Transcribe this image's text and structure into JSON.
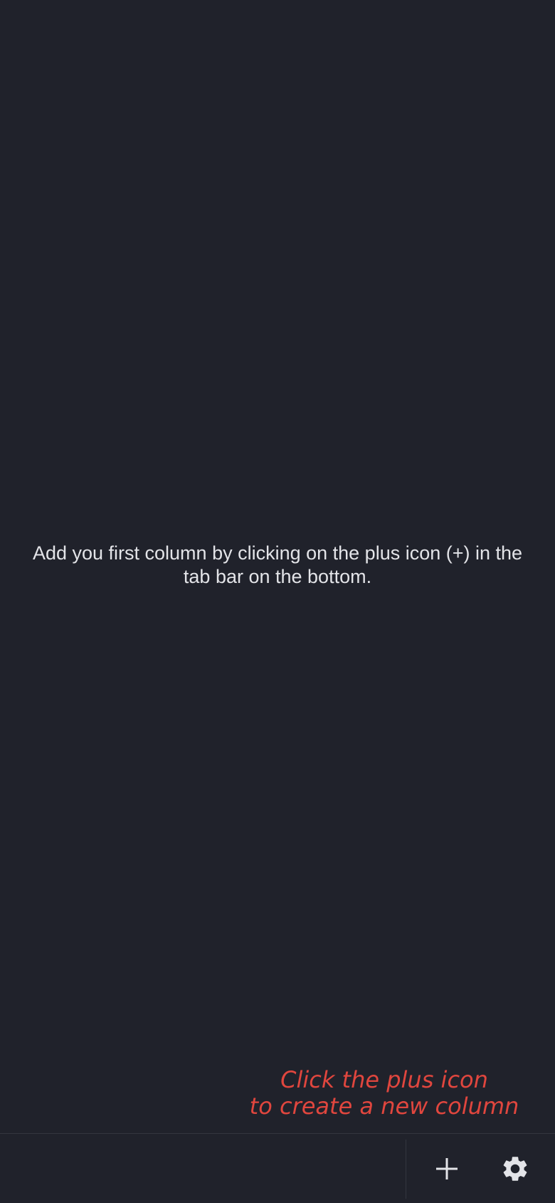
{
  "empty_state": {
    "message": "Add you first column by clicking on the plus icon (+) in the tab bar on the bottom."
  },
  "hint": {
    "line1": "Click the plus icon",
    "line2": "to create a new column",
    "color": "#e0463e"
  },
  "tab_bar": {
    "buttons": [
      {
        "icon": "plus-icon",
        "action": "add-column"
      },
      {
        "icon": "gear-icon",
        "action": "settings"
      }
    ]
  },
  "theme": {
    "background": "#20222b",
    "text": "#e3e4e8",
    "divider": "#33363f"
  }
}
